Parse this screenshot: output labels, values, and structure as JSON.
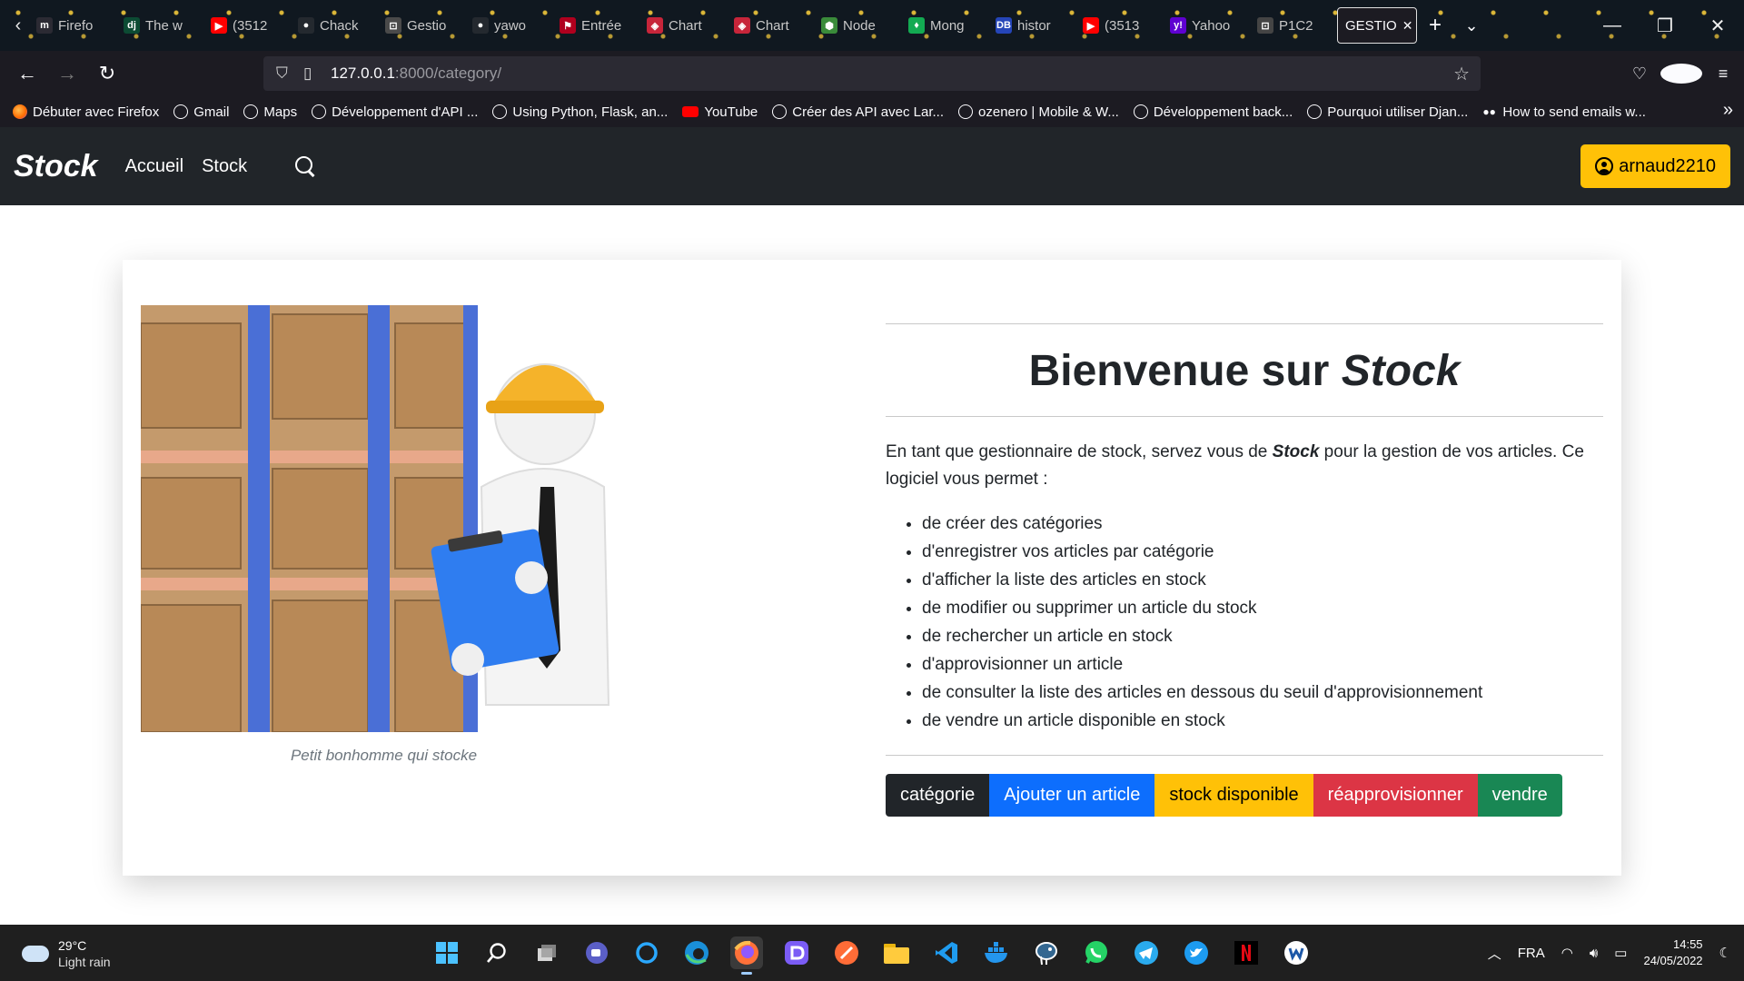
{
  "browser": {
    "tabs": [
      {
        "label": "Firefo",
        "icon": "m"
      },
      {
        "label": "The w",
        "icon": "dj"
      },
      {
        "label": "(3512",
        "icon": "▶"
      },
      {
        "label": "Chack",
        "icon": "●"
      },
      {
        "label": "Gestio",
        "icon": "⊡"
      },
      {
        "label": "yawo",
        "icon": "●"
      },
      {
        "label": "Entrée",
        "icon": "⚑"
      },
      {
        "label": "Chart",
        "icon": "◈"
      },
      {
        "label": "Chart",
        "icon": "◈"
      },
      {
        "label": "Node",
        "icon": "⬢"
      },
      {
        "label": "Mong",
        "icon": "♦"
      },
      {
        "label": "histor",
        "icon": "DB"
      },
      {
        "label": "(3513",
        "icon": "▶"
      },
      {
        "label": "Yahoo",
        "icon": "y!"
      },
      {
        "label": "P1C2",
        "icon": "⊡"
      }
    ],
    "active_tab": {
      "label": "GESTIO",
      "close": "✕"
    },
    "new_tab": "+",
    "list_tabs": "⌄",
    "window_controls": {
      "minimize": "—",
      "restore": "❐",
      "close": "✕"
    },
    "nav": {
      "back": "←",
      "forward": "→",
      "reload": "↻"
    },
    "url": {
      "host": "127.0.0.1",
      "path": ":8000/category/",
      "shield": "⛉",
      "page": "▯",
      "star": "☆"
    },
    "toolbar_right": {
      "pocket": "♡",
      "account": "A",
      "menu": "≡"
    },
    "bookmarks": [
      {
        "label": "Débuter avec Firefox",
        "icon": "ff"
      },
      {
        "label": "Gmail",
        "icon": "globe"
      },
      {
        "label": "Maps",
        "icon": "globe"
      },
      {
        "label": "Développement d'API ...",
        "icon": "globe"
      },
      {
        "label": "Using Python, Flask, an...",
        "icon": "globe"
      },
      {
        "label": "YouTube",
        "icon": "yt"
      },
      {
        "label": "Créer des API avec Lar...",
        "icon": "globe"
      },
      {
        "label": "ozenero | Mobile & W...",
        "icon": "globe"
      },
      {
        "label": "Développement back...",
        "icon": "globe"
      },
      {
        "label": "Pourquoi utiliser Djan...",
        "icon": "globe"
      },
      {
        "label": "How to send emails w...",
        "icon": "dots"
      }
    ],
    "bookmarks_more": "»"
  },
  "site": {
    "brand": "Stock",
    "links": [
      "Accueil",
      "Stock"
    ],
    "user": "arnaud2210",
    "figure_caption": "Petit bonhomme qui stocke",
    "title_prefix": "Bienvenue sur ",
    "title_brand": "Stock",
    "intro_part1": "En tant que gestionnaire de stock, servez vous de ",
    "intro_brand": "Stock",
    "intro_part2": " pour la gestion de vos articles. Ce logiciel vous permet :",
    "features": [
      "de créer des catégories",
      "d'enregistrer vos articles par catégorie",
      "d'afficher la liste des articles en stock",
      "de modifier ou supprimer un article du stock",
      "de rechercher un article en stock",
      "d'approvisionner un article",
      "de consulter la liste des articles en dessous du seuil d'approvisionnement",
      "de vendre un article disponible en stock"
    ],
    "actions": [
      {
        "label": "catégorie",
        "color": "#212529"
      },
      {
        "label": "Ajouter un article",
        "color": "#0d6efd"
      },
      {
        "label": "stock disponible",
        "color": "#ffc107"
      },
      {
        "label": "réapprovisionner",
        "color": "#dc3545"
      },
      {
        "label": "vendre",
        "color": "#198754"
      }
    ]
  },
  "taskbar": {
    "weather_temp": "29°C",
    "weather_desc": "Light rain",
    "apps": [
      "start",
      "search",
      "task-view",
      "teams",
      "cortana",
      "edge",
      "firefox",
      "discord",
      "postman",
      "explorer",
      "vscode",
      "docker",
      "postgres",
      "whatsapp",
      "telegram",
      "twitter",
      "netflix",
      "nw"
    ],
    "lang": "FRA",
    "time": "14:55",
    "date": "24/05/2022"
  }
}
